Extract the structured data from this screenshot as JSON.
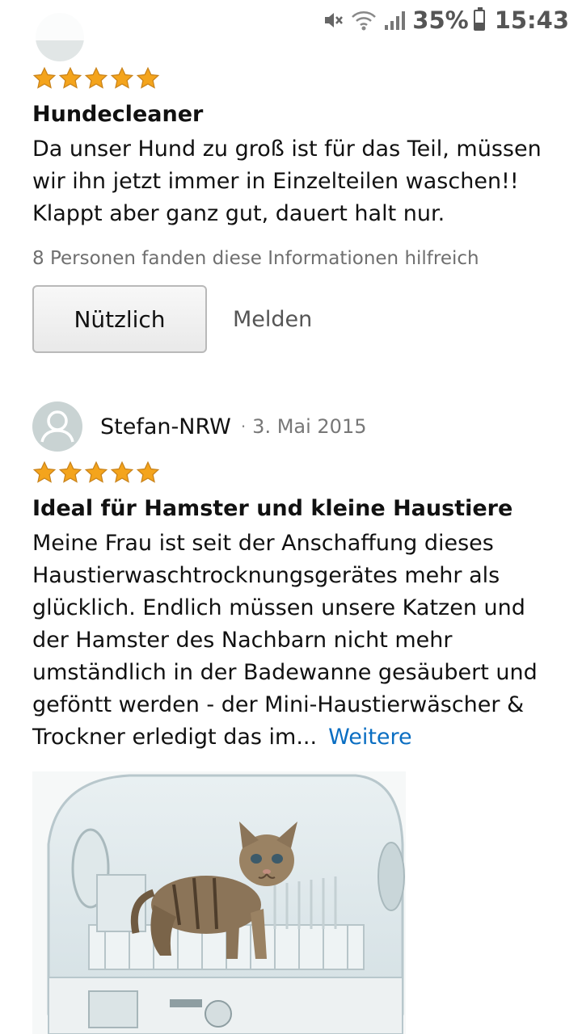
{
  "status_bar": {
    "battery": "35%",
    "battery_level": 0.35,
    "time": "15:43",
    "icons": [
      "mute-icon",
      "wifi-icon",
      "signal-icon",
      "battery-icon"
    ]
  },
  "previous_review": {
    "stars": 5,
    "title": "Hundecleaner",
    "body": "Da unser Hund zu groß ist für das Teil, müssen wir ihn jetzt immer in Einzelteilen waschen!! Klappt aber ganz gut, dauert halt nur.",
    "helpful_text": "8 Personen fanden diese Informationen hilfreich",
    "useful_label": "Nützlich",
    "report_label": "Melden"
  },
  "review": {
    "author": "Stefan-NRW",
    "separator": "·",
    "date": "3. Mai 2015",
    "stars": 5,
    "title": "Ideal für Hamster und kleine Haustiere",
    "body": "Meine Frau ist seit der Anschaffung dieses Haustierwaschtrocknungsgerätes mehr als glücklich. Endlich müssen unsere Katzen und der Hamster des Nachbarn nicht mehr umständlich in der Badewanne gesäubert und geföntt werden - der Mini-Haustierwäscher & Trockner erledigt das im...",
    "more_label": "Weitere"
  },
  "colors": {
    "star": "#f4a41c",
    "link": "#0a6ec2",
    "muted_text": "#6f6f6f"
  }
}
